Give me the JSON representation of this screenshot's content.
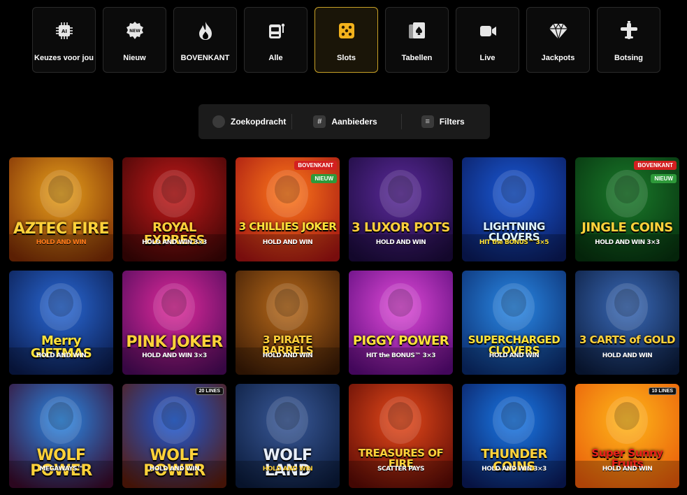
{
  "categories": [
    {
      "label": "Keuzes voor jou",
      "icon": "ai-chip-icon"
    },
    {
      "label": "Nieuw",
      "icon": "new-badge-icon"
    },
    {
      "label": "BOVENKANT",
      "icon": "flame-icon"
    },
    {
      "label": "Alle",
      "icon": "slot-machine-icon"
    },
    {
      "label": "Slots",
      "icon": "dice-icon",
      "active": true
    },
    {
      "label": "Tabellen",
      "icon": "cards-icon"
    },
    {
      "label": "Live",
      "icon": "video-camera-icon"
    },
    {
      "label": "Jackpots",
      "icon": "diamond-icon"
    },
    {
      "label": "Botsing",
      "icon": "airplane-icon"
    }
  ],
  "search": {
    "search_label": "Zoekopdracht",
    "providers_label": "Aanbieders",
    "filters_label": "Filters"
  },
  "colors": {
    "accent": "#c9a227",
    "badge_red": "#d32020",
    "badge_green": "#2e9a3a"
  },
  "games": [
    {
      "title": "AZTEC FIRE",
      "sub": "HOLD AND WIN",
      "c1": "#e8a21c",
      "c2": "#7a2a05",
      "tc": "#ffd23a",
      "sc": "#ff7a1a"
    },
    {
      "title": "ROYAL EXPRESS",
      "sub": "HOLD AND WIN 3×3",
      "c1": "#c41a1a",
      "c2": "#3a0505",
      "tc": "#ffcf3a",
      "sc": "#ffffff"
    },
    {
      "title": "3 CHILLIES JOKER",
      "sub": "HOLD AND WIN",
      "c1": "#ff7a1a",
      "c2": "#a11212",
      "tc": "#ffe23a",
      "sc": "#ffffff",
      "badges": [
        "BOVENKANT",
        "NIEUW"
      ]
    },
    {
      "title": "3 LUXOR POTS",
      "sub": "HOLD AND WIN",
      "c1": "#5b2a9a",
      "c2": "#1a0a3a",
      "tc": "#ffcf3a",
      "sc": "#ffffff"
    },
    {
      "title": "LIGHTNING CLOVERS",
      "sub": "HIT the BONUS™ 3×5",
      "c1": "#1a5ad8",
      "c2": "#0a1a5a",
      "tc": "#dff4ff",
      "sc": "#ffe23a"
    },
    {
      "title": "JINGLE COINS",
      "sub": "HOLD AND WIN 3×3",
      "c1": "#1a7a2a",
      "c2": "#06300e",
      "tc": "#ffd23a",
      "sc": "#ffffff",
      "badges": [
        "BOVENKANT",
        "NIEUW"
      ]
    },
    {
      "title": "Merry GIFTMAS",
      "sub": "HOLD AND WIN",
      "c1": "#2a6ad8",
      "c2": "#0a1a4a",
      "tc": "#ffe23a",
      "sc": "#ffffff"
    },
    {
      "title": "PINK JOKER",
      "sub": "HOLD AND WIN 3×3",
      "c1": "#e02a9a",
      "c2": "#4a0a5a",
      "tc": "#ffd23a",
      "sc": "#ffffff"
    },
    {
      "title": "3 PIRATE BARRELS",
      "sub": "HOLD AND WIN",
      "c1": "#b86a1a",
      "c2": "#3a1a05",
      "tc": "#ffcf3a",
      "sc": "#ffffff"
    },
    {
      "title": "PIGGY POWER",
      "sub": "HIT the BONUS™ 3×3",
      "c1": "#e04ad8",
      "c2": "#5a0a7a",
      "tc": "#ffe23a",
      "sc": "#ffffff"
    },
    {
      "title": "SUPERCHARGED CLOVERS",
      "sub": "HOLD AND WIN",
      "c1": "#2a8ae8",
      "c2": "#0a2a6a",
      "tc": "#ffe23a",
      "sc": "#ffffff"
    },
    {
      "title": "3 CARTS of GOLD",
      "sub": "HOLD AND WIN",
      "c1": "#3a6ab8",
      "c2": "#0a1a3a",
      "tc": "#ffd23a",
      "sc": "#ffffff"
    },
    {
      "title": "WOLF POWER",
      "sub": "MEGAWAYS™",
      "c1": "#2a8ae8",
      "c2": "#3a0a2a",
      "tc": "#ffd23a",
      "sc": "#ffffff"
    },
    {
      "title": "WOLF POWER",
      "sub": "HOLD AND WIN",
      "c1": "#1a5ad8",
      "c2": "#5a1a0a",
      "tc": "#ffd23a",
      "sc": "#ffffff",
      "lines": "20 LINES"
    },
    {
      "title": "WOLF LAND",
      "sub": "HOLD AND WIN",
      "c1": "#3a5a9a",
      "c2": "#0a1a3a",
      "tc": "#e8eef8",
      "sc": "#ffd23a"
    },
    {
      "title": "TREASURES OF FIRE",
      "sub": "SCATTER PAYS",
      "c1": "#e84a1a",
      "c2": "#5a0a05",
      "tc": "#ffd23a",
      "sc": "#ffffff"
    },
    {
      "title": "THUNDER COINS",
      "sub": "HOLD AND WIN 3×3",
      "c1": "#1a7ae8",
      "c2": "#0a1a5a",
      "tc": "#ffd23a",
      "sc": "#ffffff"
    },
    {
      "title": "Super Sunny Fruits",
      "sub": "HOLD AND WIN",
      "c1": "#ffb81a",
      "c2": "#e85a0a",
      "tc": "#e8201a",
      "sc": "#ffffff",
      "lines": "10 LINES"
    }
  ]
}
